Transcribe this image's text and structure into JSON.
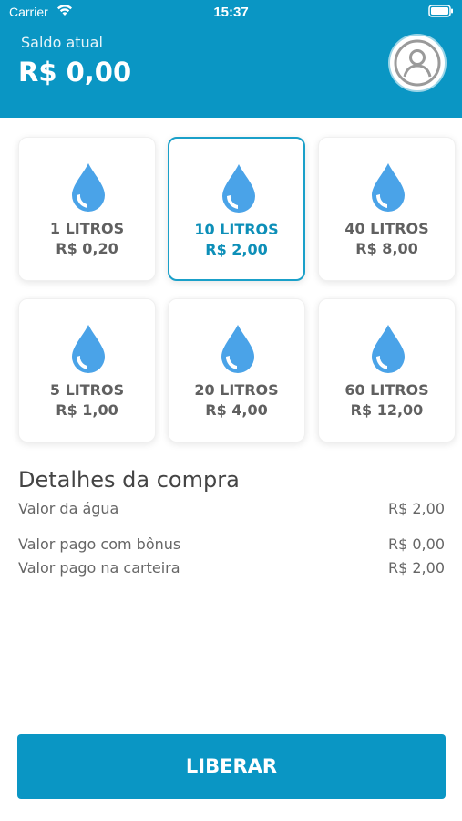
{
  "status_bar": {
    "carrier": "Carrier",
    "time": "15:37"
  },
  "header": {
    "balance_label": "Saldo atual",
    "balance_value": "R$ 0,00"
  },
  "products": [
    {
      "liters": "1 LITROS",
      "price": "R$ 0,20",
      "selected": false
    },
    {
      "liters": "10 LITROS",
      "price": "R$ 2,00",
      "selected": true
    },
    {
      "liters": "40 LITROS",
      "price": "R$ 8,00",
      "selected": false
    },
    {
      "liters": "5 LITROS",
      "price": "R$ 1,00",
      "selected": false
    },
    {
      "liters": "20 LITROS",
      "price": "R$ 4,00",
      "selected": false
    },
    {
      "liters": "60 LITROS",
      "price": "R$ 12,00",
      "selected": false
    }
  ],
  "details": {
    "title": "Detalhes da compra",
    "rows": [
      {
        "label": "Valor da água",
        "value": "R$ 2,00"
      },
      {
        "label": "Valor pago com bônus",
        "value": "R$ 0,00"
      },
      {
        "label": "Valor pago na carteira",
        "value": "R$ 2,00"
      }
    ]
  },
  "action": {
    "button_label": "LIBERAR"
  },
  "colors": {
    "brand": "#0a96c4",
    "drop": "#4aa3e8",
    "selected_text": "#0d8fb8"
  },
  "icons": [
    "wifi-icon",
    "battery-icon",
    "user-avatar-icon",
    "water-drop-icon"
  ]
}
